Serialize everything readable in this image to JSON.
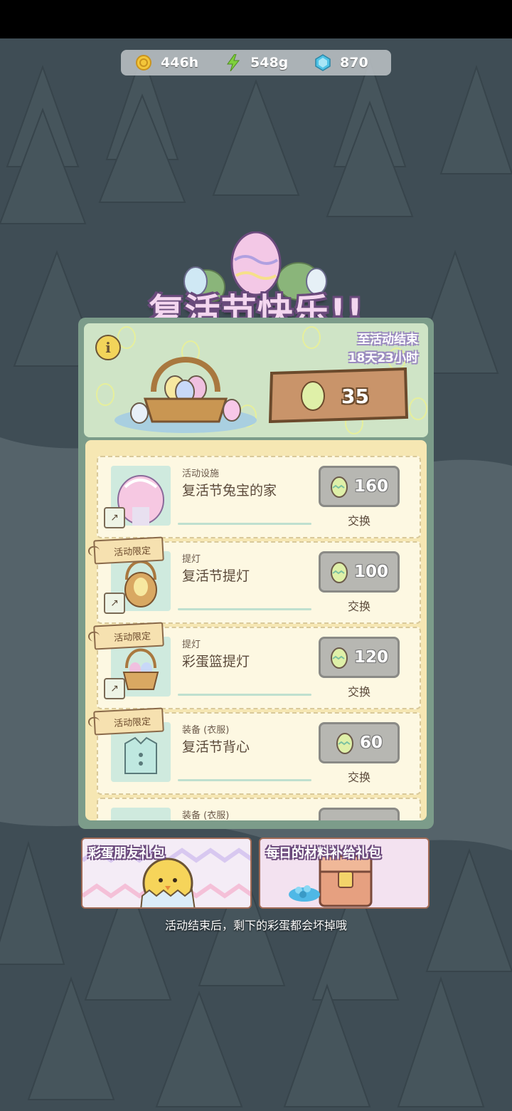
{
  "resources": {
    "coins": "446h",
    "energy": "548g",
    "gems": "870"
  },
  "event": {
    "title": "复活节快乐!!",
    "timer_label": "至活动结束",
    "timer_value": "18天23小时",
    "egg_count": "35"
  },
  "shop_items": [
    {
      "category": "活动设施",
      "name": "复活节兔宝的家",
      "price": "160",
      "exchange_label": "交换",
      "tag": ""
    },
    {
      "category": "提灯",
      "name": "复活节提灯",
      "price": "100",
      "exchange_label": "交换",
      "tag": "活动限定"
    },
    {
      "category": "提灯",
      "name": "彩蛋篮提灯",
      "price": "120",
      "exchange_label": "交换",
      "tag": "活动限定"
    },
    {
      "category": "装备 (衣服)",
      "name": "复活节背心",
      "price": "60",
      "exchange_label": "交换",
      "tag": "活动限定"
    },
    {
      "category": "装备 (衣服)",
      "name": "",
      "price": "",
      "exchange_label": "",
      "tag": ""
    }
  ],
  "banners": {
    "friend_pack": "彩蛋朋友礼包",
    "daily_pack": "每日的材料补给礼包"
  },
  "footer_note": "活动结束后，剩下的彩蛋都会坏掉哦",
  "colors": {
    "panel_green": "#cfe4c6",
    "list_bg": "#f6e7b3",
    "price_button": "#b7b7b2",
    "title_pink": "#f4d6f0"
  }
}
